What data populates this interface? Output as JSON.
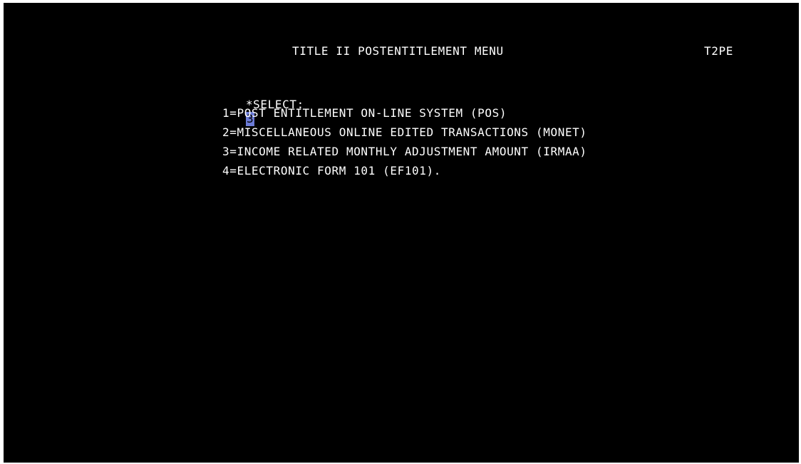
{
  "header": {
    "title": "TITLE II POSTENTITLEMENT MENU",
    "screen_id": "T2PE"
  },
  "select": {
    "label": "*SELECT:",
    "value": "3"
  },
  "options": [
    "1=POST ENTITLEMENT ON-LINE SYSTEM (POS)",
    "2=MISCELLANEOUS ONLINE EDITED TRANSACTIONS (MONET)",
    "3=INCOME RELATED MONTHLY ADJUSTMENT AMOUNT (IRMAA)",
    "4=ELECTRONIC FORM 101 (EF101)."
  ],
  "colors": {
    "background": "#000000",
    "text": "#ffffff",
    "cursor": "#6b7bd6"
  }
}
